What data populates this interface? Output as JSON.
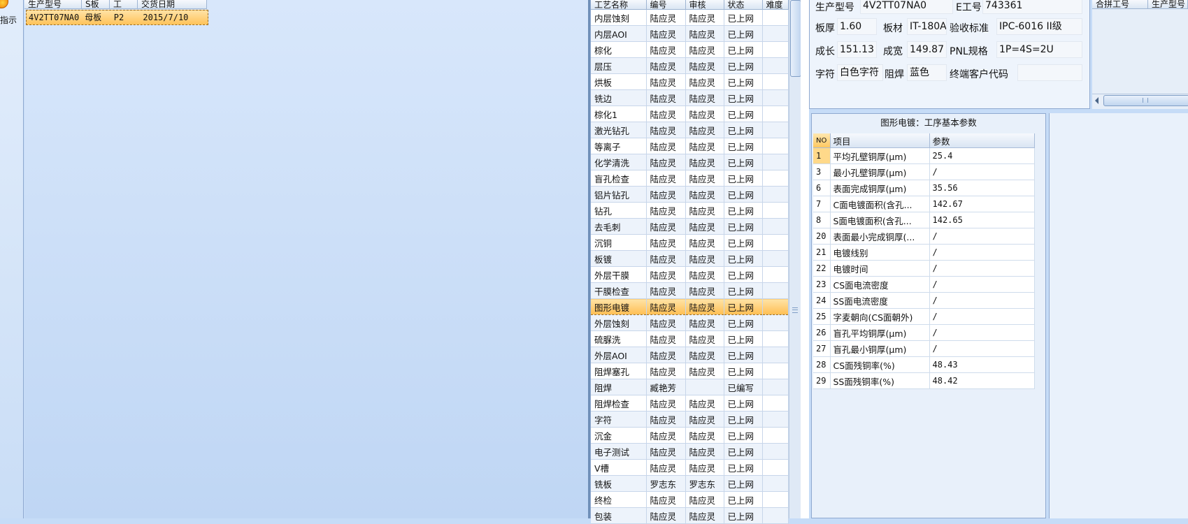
{
  "left_strip": {
    "label": "指示"
  },
  "orders_grid": {
    "columns": [
      "生产型号",
      "S板",
      "工",
      "交货日期"
    ],
    "rows": [
      {
        "cells": [
          "4V2TT07NA0",
          "母板",
          "P2",
          "2015/7/10"
        ]
      }
    ]
  },
  "process_list": {
    "columns": [
      "工艺名称",
      "编号",
      "审核",
      "状态",
      "难度"
    ],
    "rows": [
      [
        "内层蚀刻",
        "陆应灵",
        "陆应灵",
        "已上网",
        ""
      ],
      [
        "内层AOI",
        "陆应灵",
        "陆应灵",
        "已上网",
        ""
      ],
      [
        "棕化",
        "陆应灵",
        "陆应灵",
        "已上网",
        ""
      ],
      [
        "层压",
        "陆应灵",
        "陆应灵",
        "已上网",
        ""
      ],
      [
        "烘板",
        "陆应灵",
        "陆应灵",
        "已上网",
        ""
      ],
      [
        "铣边",
        "陆应灵",
        "陆应灵",
        "已上网",
        ""
      ],
      [
        "棕化1",
        "陆应灵",
        "陆应灵",
        "已上网",
        ""
      ],
      [
        "激光钻孔",
        "陆应灵",
        "陆应灵",
        "已上网",
        ""
      ],
      [
        "等离子",
        "陆应灵",
        "陆应灵",
        "已上网",
        ""
      ],
      [
        "化学清洗",
        "陆应灵",
        "陆应灵",
        "已上网",
        ""
      ],
      [
        "盲孔检查",
        "陆应灵",
        "陆应灵",
        "已上网",
        ""
      ],
      [
        "铝片钻孔",
        "陆应灵",
        "陆应灵",
        "已上网",
        ""
      ],
      [
        "钻孔",
        "陆应灵",
        "陆应灵",
        "已上网",
        ""
      ],
      [
        "去毛刺",
        "陆应灵",
        "陆应灵",
        "已上网",
        ""
      ],
      [
        "沉铜",
        "陆应灵",
        "陆应灵",
        "已上网",
        ""
      ],
      [
        "板镀",
        "陆应灵",
        "陆应灵",
        "已上网",
        ""
      ],
      [
        "外层干膜",
        "陆应灵",
        "陆应灵",
        "已上网",
        ""
      ],
      [
        "干膜检查",
        "陆应灵",
        "陆应灵",
        "已上网",
        ""
      ],
      [
        "图形电镀",
        "陆应灵",
        "陆应灵",
        "已上网",
        ""
      ],
      [
        "外层蚀刻",
        "陆应灵",
        "陆应灵",
        "已上网",
        ""
      ],
      [
        "硫脲洗",
        "陆应灵",
        "陆应灵",
        "已上网",
        ""
      ],
      [
        "外层AOI",
        "陆应灵",
        "陆应灵",
        "已上网",
        ""
      ],
      [
        "阻焊塞孔",
        "陆应灵",
        "陆应灵",
        "已上网",
        ""
      ],
      [
        "阻焊",
        "臧艳芳",
        "",
        "已编写",
        ""
      ],
      [
        "阻焊检查",
        "陆应灵",
        "陆应灵",
        "已上网",
        ""
      ],
      [
        "字符",
        "陆应灵",
        "陆应灵",
        "已上网",
        ""
      ],
      [
        "沉金",
        "陆应灵",
        "陆应灵",
        "已上网",
        ""
      ],
      [
        "电子测试",
        "陆应灵",
        "陆应灵",
        "已上网",
        ""
      ],
      [
        "V槽",
        "陆应灵",
        "陆应灵",
        "已上网",
        ""
      ],
      [
        "铣板",
        "罗志东",
        "罗志东",
        "已上网",
        ""
      ],
      [
        "终检",
        "陆应灵",
        "陆应灵",
        "已上网",
        ""
      ],
      [
        "包装",
        "陆应灵",
        "陆应灵",
        "已上网",
        ""
      ]
    ],
    "selected_index": 18
  },
  "info": {
    "model_label": "生产型号",
    "model_value": "4V2TT07NA0",
    "e_label": "E工号",
    "e_value": "743361",
    "thick_label": "板厚",
    "thick_value": "1.60",
    "material_label": "板材",
    "material_value": "IT-180A",
    "std_label": "验收标准",
    "std_value": "IPC-6016 II级",
    "len_label": "成长",
    "len_value": "151.13",
    "width_label": "成宽",
    "width_value": "149.87",
    "pnl_label": "PNL规格",
    "pnl_value": "1P=4S=2U",
    "char_label": "字符",
    "char_value": "白色字符",
    "mask_label": "阻焊",
    "mask_value": "蓝色",
    "cust_label": "终端客户代码",
    "cust_value": ""
  },
  "right_top": {
    "columns": [
      "合拼工号",
      "生产型号"
    ]
  },
  "params": {
    "title": "图形电镀：工序基本参数",
    "columns": [
      "NO",
      "项目",
      "参数"
    ],
    "rows": [
      [
        "1",
        "平均孔壁铜厚(μm)",
        "25.4"
      ],
      [
        "3",
        "最小孔壁铜厚(μm)",
        "/"
      ],
      [
        "6",
        "表面完成铜厚(μm)",
        "35.56"
      ],
      [
        "7",
        "C面电镀面积(含孔...",
        "142.67"
      ],
      [
        "8",
        "S面电镀面积(含孔...",
        "142.65"
      ],
      [
        "20",
        "表面最小完成铜厚(...",
        "/"
      ],
      [
        "21",
        "电镀线别",
        "/"
      ],
      [
        "22",
        "电镀时间",
        "/"
      ],
      [
        "23",
        "CS面电流密度",
        "/"
      ],
      [
        "24",
        "SS面电流密度",
        "/"
      ],
      [
        "25",
        "字麦朝向(CS面朝外)",
        "/"
      ],
      [
        "26",
        "盲孔平均铜厚(μm)",
        "/"
      ],
      [
        "27",
        "盲孔最小铜厚(μm)",
        "/"
      ],
      [
        "28",
        "CS面残铜率(%)",
        "48.43"
      ],
      [
        "29",
        "SS面残铜率(%)",
        "48.42"
      ]
    ]
  }
}
